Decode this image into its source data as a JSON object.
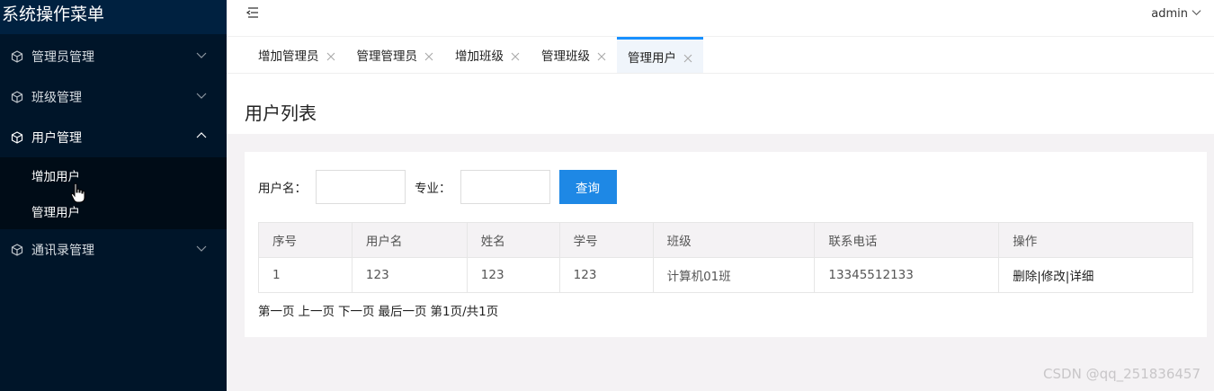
{
  "sidebar": {
    "title": "系统操作菜单",
    "groups": [
      {
        "label": "管理员管理",
        "icon": "cube-icon",
        "open": false
      },
      {
        "label": "班级管理",
        "icon": "cube-icon",
        "open": false
      },
      {
        "label": "用户管理",
        "icon": "cube-icon",
        "open": true,
        "items": [
          "增加用户",
          "管理用户"
        ]
      },
      {
        "label": "通讯录管理",
        "icon": "cube-icon",
        "open": false
      }
    ]
  },
  "topbar": {
    "fold_icon": "menu-fold-icon",
    "user": "admin"
  },
  "tabs": [
    {
      "label": "增加管理员"
    },
    {
      "label": "管理管理员"
    },
    {
      "label": "增加班级"
    },
    {
      "label": "管理班级"
    },
    {
      "label": "管理用户",
      "active": true
    }
  ],
  "page": {
    "title": "用户列表"
  },
  "search": {
    "username_label": "用户名：",
    "major_label": "专业：",
    "button": "查询"
  },
  "table": {
    "headers": [
      "序号",
      "用户名",
      "姓名",
      "学号",
      "班级",
      "联系电话",
      "操作"
    ],
    "rows": [
      [
        "1",
        "123",
        "123",
        "123",
        "计算机01班",
        "13345512133",
        "删除|修改|详细"
      ]
    ]
  },
  "pager": {
    "first": "第一页",
    "prev": "上一页",
    "next": "下一页",
    "last": "最后一页",
    "status": "第1页/共1页"
  },
  "watermark": "CSDN @qq_251836457",
  "colors": {
    "sidebar_bg": "#001529",
    "accent": "#1890ff",
    "button": "#1e88e5"
  }
}
